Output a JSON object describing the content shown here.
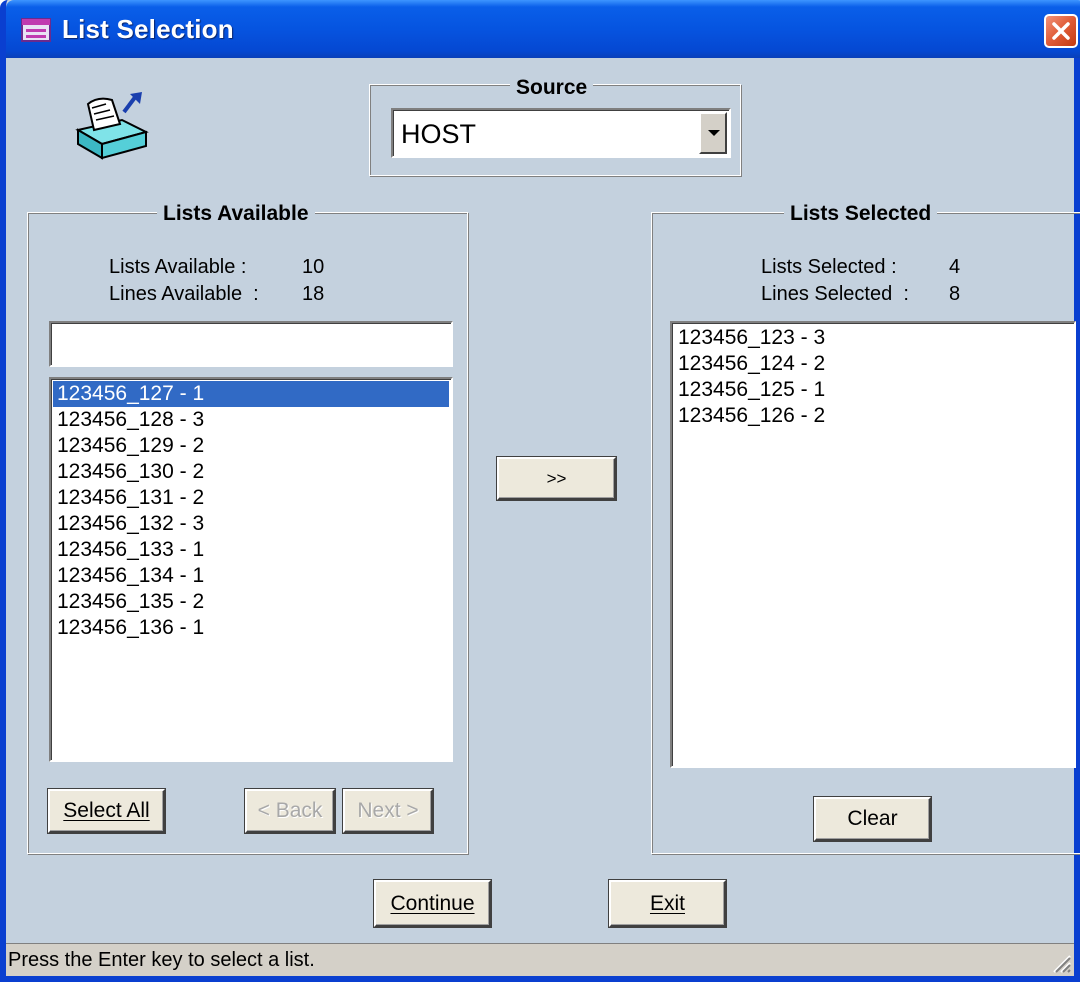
{
  "window": {
    "title": "List Selection"
  },
  "source": {
    "label": "Source",
    "value": "HOST"
  },
  "available": {
    "group_label": "Lists Available",
    "lists_label": "Lists Available :",
    "lists_count": "10",
    "lines_label": "Lines Available  :",
    "lines_count": "18",
    "filter_value": "",
    "items": [
      "123456_127 - 1",
      "123456_128 - 3",
      "123456_129 - 2",
      "123456_130 - 2",
      "123456_131 - 2",
      "123456_132 - 3",
      "123456_133 - 1",
      "123456_134 - 1",
      "123456_135 - 2",
      "123456_136 - 1"
    ],
    "selected_item": "123456_127 - 1"
  },
  "selected": {
    "group_label": "Lists Selected",
    "lists_label": "Lists Selected :",
    "lists_count": "4",
    "lines_label": "Lines Selected  :",
    "lines_count": "8",
    "items": [
      "123456_123 - 3",
      "123456_124 - 2",
      "123456_125 - 1",
      "123456_126 - 2"
    ]
  },
  "buttons": {
    "move": ">>",
    "select_all": "Select All",
    "back": "< Back",
    "next": "Next >",
    "clear": "Clear",
    "continue": "Continue",
    "exit": "Exit"
  },
  "status": {
    "text": "Press the Enter key to select a list."
  },
  "icons": {
    "title": "app-window-icon",
    "app": "tissue-box-icon",
    "close": "close-icon",
    "dropdown": "chevron-down-icon",
    "grip": "resize-grip-icon"
  },
  "colors": {
    "titlebar": "#0654e0",
    "dialog": "#c4d1de",
    "selection": "#316ac5",
    "close": "#e05b36"
  }
}
